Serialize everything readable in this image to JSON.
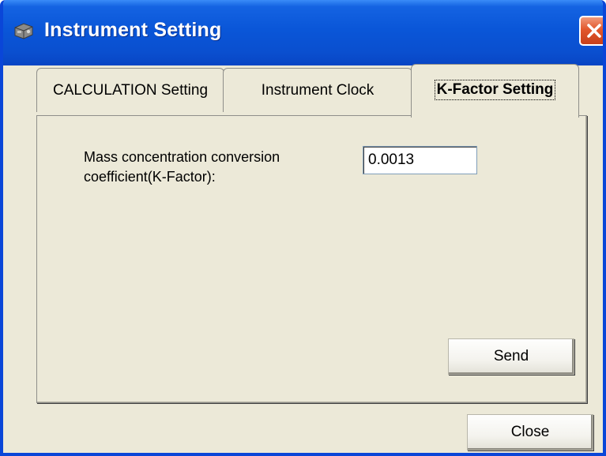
{
  "window": {
    "title": "Instrument Setting",
    "icon": "instrument-icon",
    "close_icon": "close-x-icon"
  },
  "tabs": [
    {
      "label": "CALCULATION Setting",
      "selected": false
    },
    {
      "label": "Instrument Clock",
      "selected": false
    },
    {
      "label": "K-Factor Setting",
      "selected": true
    }
  ],
  "kfactor_panel": {
    "label_line1": "Mass concentration conversion",
    "label_line2": "coefficient(K-Factor):",
    "value": "0.0013",
    "send_label": "Send"
  },
  "footer": {
    "close_label": "Close"
  },
  "colors": {
    "titlebar": "#0a56d8",
    "dialog_face": "#ece9d8",
    "close_button": "#e2572c"
  }
}
